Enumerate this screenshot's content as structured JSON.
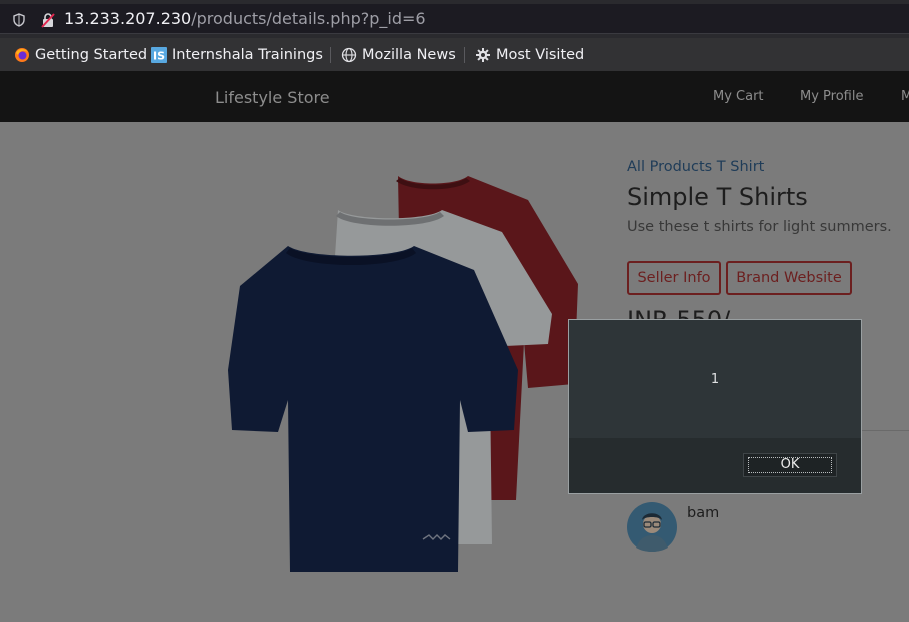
{
  "browser": {
    "url_host": "13.233.207.230",
    "url_path": "/products/details.php?p_id=6",
    "bookmarks": [
      {
        "label": "Getting Started",
        "icon": "firefox-icon"
      },
      {
        "label": "Internshala Trainings",
        "icon": "internshala-icon"
      },
      {
        "label": "Mozilla News",
        "icon": "globe-icon"
      },
      {
        "label": "Most Visited",
        "icon": "gear-icon"
      }
    ]
  },
  "site": {
    "brand": "Lifestyle Store",
    "nav": [
      "My Cart",
      "My Profile",
      "M"
    ]
  },
  "product": {
    "breadcrumb": "All Products T Shirt",
    "title": "Simple T Shirts",
    "description": "Use these t shirts for light summers.",
    "seller_info_label": "Seller Info",
    "brand_website_label": "Brand Website",
    "price": "INR 550/-",
    "shirt_colors": [
      "#a82028",
      "#d8dadb",
      "#1f2f5c"
    ]
  },
  "comment": {
    "username": "bam"
  },
  "alert": {
    "message": "1",
    "ok_label": "OK"
  },
  "colors": {
    "overlay_bg": "#7b7b7b",
    "navbar_bg": "#141414",
    "accent_button": "#6c1f1f",
    "modal_bg": "#2e3538"
  }
}
